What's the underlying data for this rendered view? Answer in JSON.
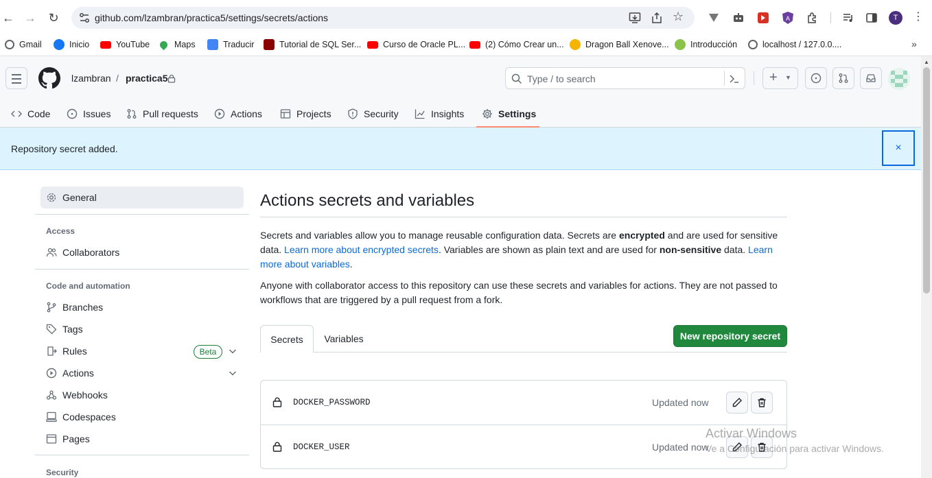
{
  "browser": {
    "url": "github.com/lzambran/practica5/settings/secrets/actions",
    "profile_initial": "T"
  },
  "bookmarks": [
    {
      "label": "Gmail",
      "color": "#ea4335"
    },
    {
      "label": "Inicio",
      "color": "#1877f2"
    },
    {
      "label": "YouTube",
      "color": "#ff0000"
    },
    {
      "label": "Maps",
      "color": "#34a853"
    },
    {
      "label": "Traducir",
      "color": "#4285f4"
    },
    {
      "label": "Tutorial de SQL Ser...",
      "color": "#8b0000"
    },
    {
      "label": "Curso de Oracle PL...",
      "color": "#ff0000"
    },
    {
      "label": "(2) Cómo Crear un...",
      "color": "#ff0000"
    },
    {
      "label": "Dragon Ball Xenove...",
      "color": "#f4b400"
    },
    {
      "label": "Introducción",
      "color": "#8bc34a"
    },
    {
      "label": "localhost / 127.0.0....",
      "color": "#5f6368"
    }
  ],
  "header": {
    "owner": "lzambran",
    "separator": "/",
    "repo": "practica5",
    "search_placeholder": "Type / to search"
  },
  "repo_tabs": [
    {
      "label": "Code",
      "icon": "code-icon"
    },
    {
      "label": "Issues",
      "icon": "issue-icon"
    },
    {
      "label": "Pull requests",
      "icon": "pull-request-icon"
    },
    {
      "label": "Actions",
      "icon": "play-icon"
    },
    {
      "label": "Projects",
      "icon": "table-icon"
    },
    {
      "label": "Security",
      "icon": "shield-icon"
    },
    {
      "label": "Insights",
      "icon": "graph-icon"
    },
    {
      "label": "Settings",
      "icon": "gear-icon"
    }
  ],
  "flash": {
    "message": "Repository secret added.",
    "close": "×"
  },
  "sidebar": {
    "general": "General",
    "access_heading": "Access",
    "collaborators": "Collaborators",
    "code_heading": "Code and automation",
    "branches": "Branches",
    "tags": "Tags",
    "rules": "Rules",
    "rules_badge": "Beta",
    "actions": "Actions",
    "webhooks": "Webhooks",
    "codespaces": "Codespaces",
    "pages": "Pages",
    "security_heading": "Security"
  },
  "main": {
    "title": "Actions secrets and variables",
    "p1_a": "Secrets and variables allow you to manage reusable configuration data. Secrets are ",
    "p1_b": "encrypted",
    "p1_c": " and are used for sensitive data. ",
    "p1_link1": "Learn more about encrypted secrets",
    "p1_d": ". Variables are shown as plain text and are used for ",
    "p1_e": "non-sensitive",
    "p1_f": " data. ",
    "p1_link2": "Learn more about variables",
    "p1_g": ".",
    "p2": "Anyone with collaborator access to this repository can use these secrets and variables for actions. They are not passed to workflows that are triggered by a pull request from a fork.",
    "tab_secrets": "Secrets",
    "tab_variables": "Variables",
    "new_button": "New repository secret",
    "secrets": [
      {
        "name": "DOCKER_PASSWORD",
        "updated": "Updated now"
      },
      {
        "name": "DOCKER_USER",
        "updated": "Updated now"
      }
    ]
  },
  "watermark": {
    "line1": "Activar Windows",
    "line2": "Ve a Configuración para activar Windows."
  }
}
